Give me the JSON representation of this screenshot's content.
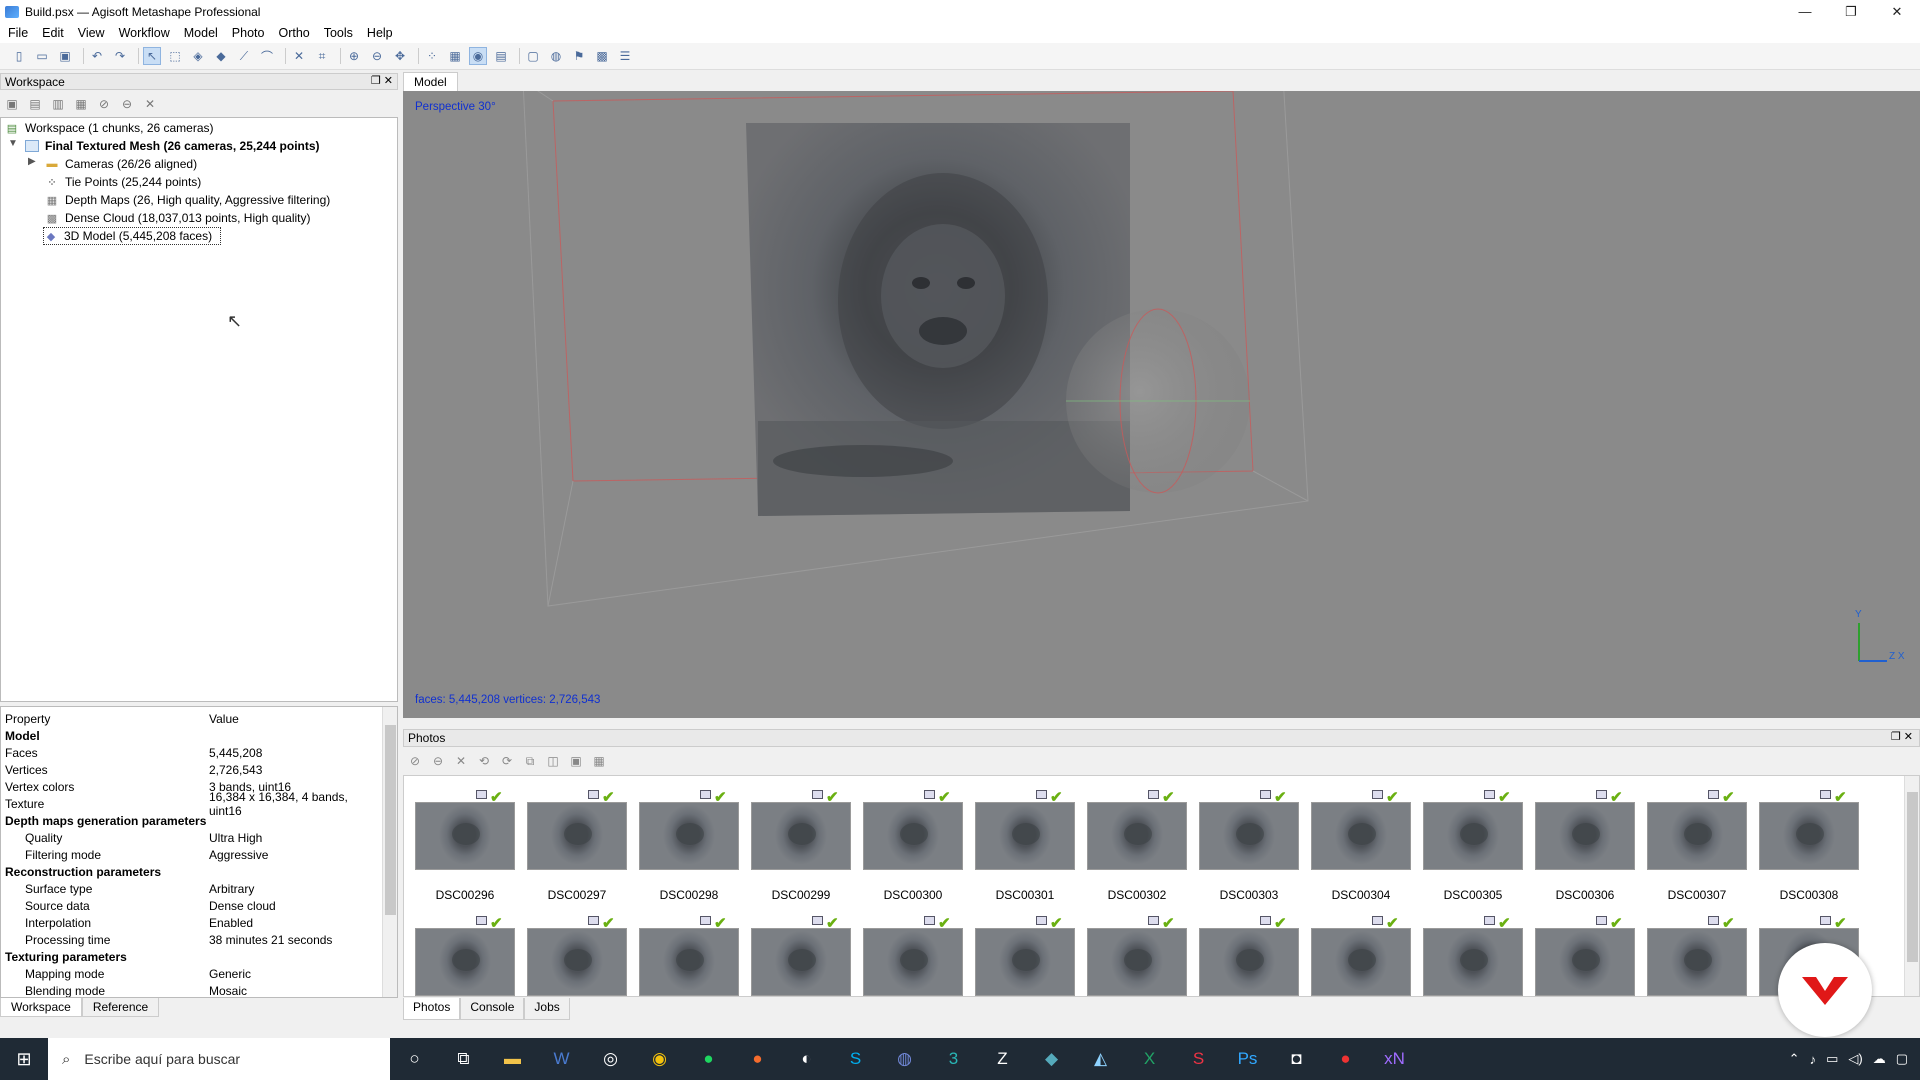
{
  "window": {
    "title": "Build.psx — Agisoft Metashape Professional",
    "minimize": "—",
    "maximize": "❐",
    "close": "✕"
  },
  "menu": [
    "File",
    "Edit",
    "View",
    "Workflow",
    "Model",
    "Photo",
    "Ortho",
    "Tools",
    "Help"
  ],
  "workspace": {
    "panel_title": "Workspace",
    "tree": {
      "root": "Workspace (1 chunks, 26 cameras)",
      "chunk": "Final Textured Mesh (26 cameras, 25,244 points)",
      "cameras": "Cameras (26/26 aligned)",
      "tie_points": "Tie Points (25,244 points)",
      "depth_maps": "Depth Maps (26, High quality, Aggressive filtering)",
      "dense_cloud": "Dense Cloud (18,037,013 points, High quality)",
      "model": "3D Model (5,445,208 faces)"
    },
    "tabs": [
      "Workspace",
      "Reference"
    ]
  },
  "properties": {
    "header": {
      "property": "Property",
      "value": "Value"
    },
    "rows": [
      {
        "k": "Model",
        "v": "",
        "type": "sec"
      },
      {
        "k": "Faces",
        "v": "5,445,208",
        "type": ""
      },
      {
        "k": "Vertices",
        "v": "2,726,543",
        "type": ""
      },
      {
        "k": "Vertex colors",
        "v": "3 bands, uint16",
        "type": ""
      },
      {
        "k": "Texture",
        "v": "16,384 x 16,384, 4 bands, uint16",
        "type": ""
      },
      {
        "k": "Depth maps generation parameters",
        "v": "",
        "type": "sec"
      },
      {
        "k": "Quality",
        "v": "Ultra High",
        "type": "ind"
      },
      {
        "k": "Filtering mode",
        "v": "Aggressive",
        "type": "ind"
      },
      {
        "k": "Reconstruction parameters",
        "v": "",
        "type": "sec"
      },
      {
        "k": "Surface type",
        "v": "Arbitrary",
        "type": "ind"
      },
      {
        "k": "Source data",
        "v": "Dense cloud",
        "type": "ind"
      },
      {
        "k": "Interpolation",
        "v": "Enabled",
        "type": "ind"
      },
      {
        "k": "Processing time",
        "v": "38 minutes 21 seconds",
        "type": "ind"
      },
      {
        "k": "Texturing parameters",
        "v": "",
        "type": "sec"
      },
      {
        "k": "Mapping mode",
        "v": "Generic",
        "type": "ind"
      },
      {
        "k": "Blending mode",
        "v": "Mosaic",
        "type": "ind"
      }
    ]
  },
  "model_view": {
    "tab": "Model",
    "projection": "Perspective 30°",
    "stats": "faces: 5,445,208 vertices: 2,726,543",
    "axis_y": "Y",
    "axis_zx": "Z X"
  },
  "photos": {
    "panel_title": "Photos",
    "row1": [
      "DSC00296",
      "DSC00297",
      "DSC00298",
      "DSC00299",
      "DSC00300",
      "DSC00301",
      "DSC00302",
      "DSC00303",
      "DSC00304",
      "DSC00305",
      "DSC00306",
      "DSC00307",
      "DSC00308"
    ],
    "tabs": [
      "Photos",
      "Console",
      "Jobs"
    ]
  },
  "taskbar": {
    "search_placeholder": "Escribe aquí para buscar"
  },
  "colors": {
    "accent": "#1030d0",
    "check": "#6ab012",
    "viewport": "#8a8a8a",
    "brand": "#e01818"
  }
}
